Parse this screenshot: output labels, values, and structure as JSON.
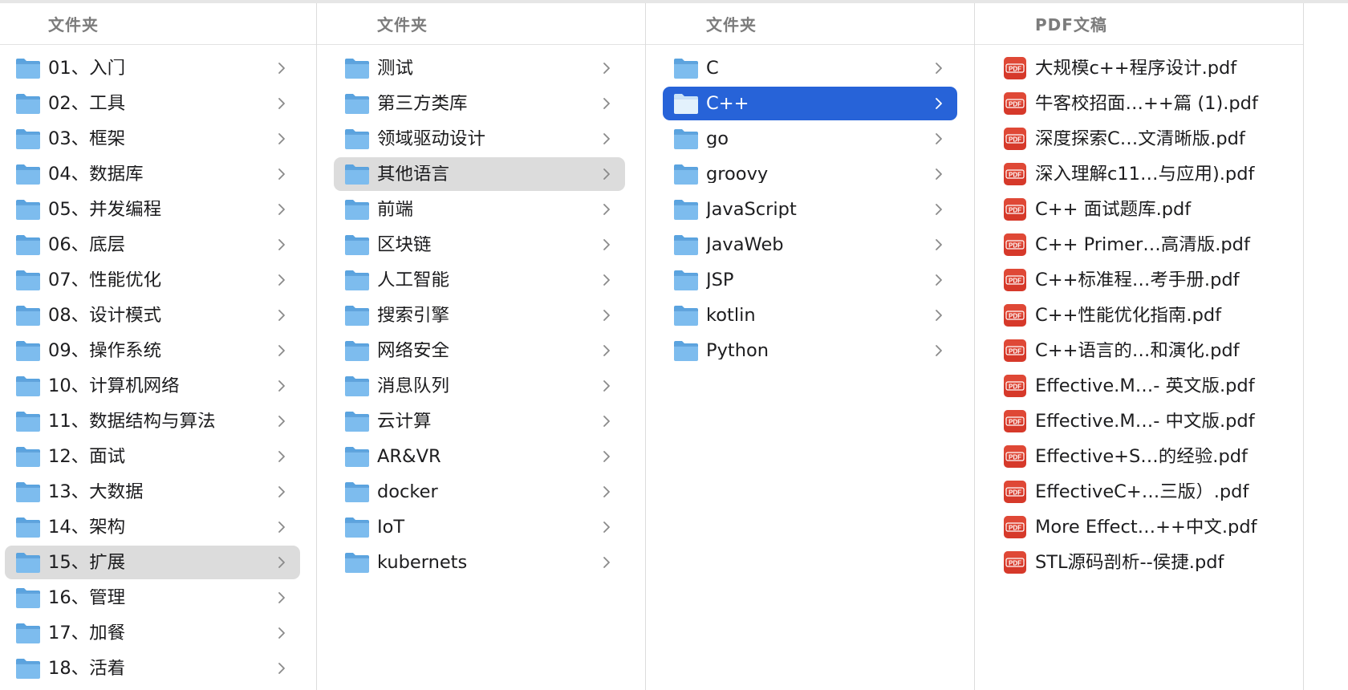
{
  "colors": {
    "selected_blue": "#2763d8",
    "selected_gray": "#dcdcdc",
    "folder": "#72b3e8",
    "pdf": "#d6392a"
  },
  "icons": {
    "folder": "folder-icon",
    "pdf": "pdf-file-icon",
    "chevron": "chevron-right-icon"
  },
  "columns": [
    {
      "header": "文件夹",
      "items": [
        {
          "label": "01、入门"
        },
        {
          "label": "02、工具"
        },
        {
          "label": "03、框架"
        },
        {
          "label": "04、数据库"
        },
        {
          "label": "05、并发编程"
        },
        {
          "label": "06、底层"
        },
        {
          "label": "07、性能优化"
        },
        {
          "label": "08、设计模式"
        },
        {
          "label": "09、操作系统"
        },
        {
          "label": "10、计算机网络"
        },
        {
          "label": "11、数据结构与算法"
        },
        {
          "label": "12、面试"
        },
        {
          "label": "13、大数据"
        },
        {
          "label": "14、架构"
        },
        {
          "label": "15、扩展",
          "selected": "gray"
        },
        {
          "label": "16、管理"
        },
        {
          "label": "17、加餐"
        },
        {
          "label": "18、活着"
        }
      ]
    },
    {
      "header": "文件夹",
      "items": [
        {
          "label": "测试"
        },
        {
          "label": "第三方类库"
        },
        {
          "label": "领域驱动设计"
        },
        {
          "label": "其他语言",
          "selected": "gray"
        },
        {
          "label": "前端"
        },
        {
          "label": "区块链"
        },
        {
          "label": "人工智能"
        },
        {
          "label": "搜索引擎"
        },
        {
          "label": "网络安全"
        },
        {
          "label": "消息队列"
        },
        {
          "label": "云计算"
        },
        {
          "label": "AR&VR"
        },
        {
          "label": "docker"
        },
        {
          "label": "IoT"
        },
        {
          "label": "kubernets"
        }
      ]
    },
    {
      "header": "文件夹",
      "items": [
        {
          "label": "C"
        },
        {
          "label": "C++",
          "selected": "blue"
        },
        {
          "label": "go"
        },
        {
          "label": "groovy"
        },
        {
          "label": "JavaScript"
        },
        {
          "label": "JavaWeb"
        },
        {
          "label": "JSP"
        },
        {
          "label": "kotlin"
        },
        {
          "label": "Python"
        }
      ]
    },
    {
      "header": "PDF文稿",
      "items": [
        {
          "label": "大规模c++程序设计.pdf"
        },
        {
          "label": "牛客校招面…++篇 (1).pdf"
        },
        {
          "label": "深度探索C…文清晰版.pdf"
        },
        {
          "label": "深入理解c11…与应用).pdf"
        },
        {
          "label": "C++ 面试题库.pdf"
        },
        {
          "label": "C++ Primer…高清版.pdf"
        },
        {
          "label": "C++标准程…考手册.pdf"
        },
        {
          "label": "C++性能优化指南.pdf"
        },
        {
          "label": "C++语言的…和演化.pdf"
        },
        {
          "label": "Effective.M…- 英文版.pdf"
        },
        {
          "label": "Effective.M…- 中文版.pdf"
        },
        {
          "label": "Effective+S…的经验.pdf"
        },
        {
          "label": "EffectiveC+…三版）.pdf"
        },
        {
          "label": "More Effect…++中文.pdf"
        },
        {
          "label": "STL源码剖析--侯捷.pdf"
        }
      ]
    }
  ]
}
